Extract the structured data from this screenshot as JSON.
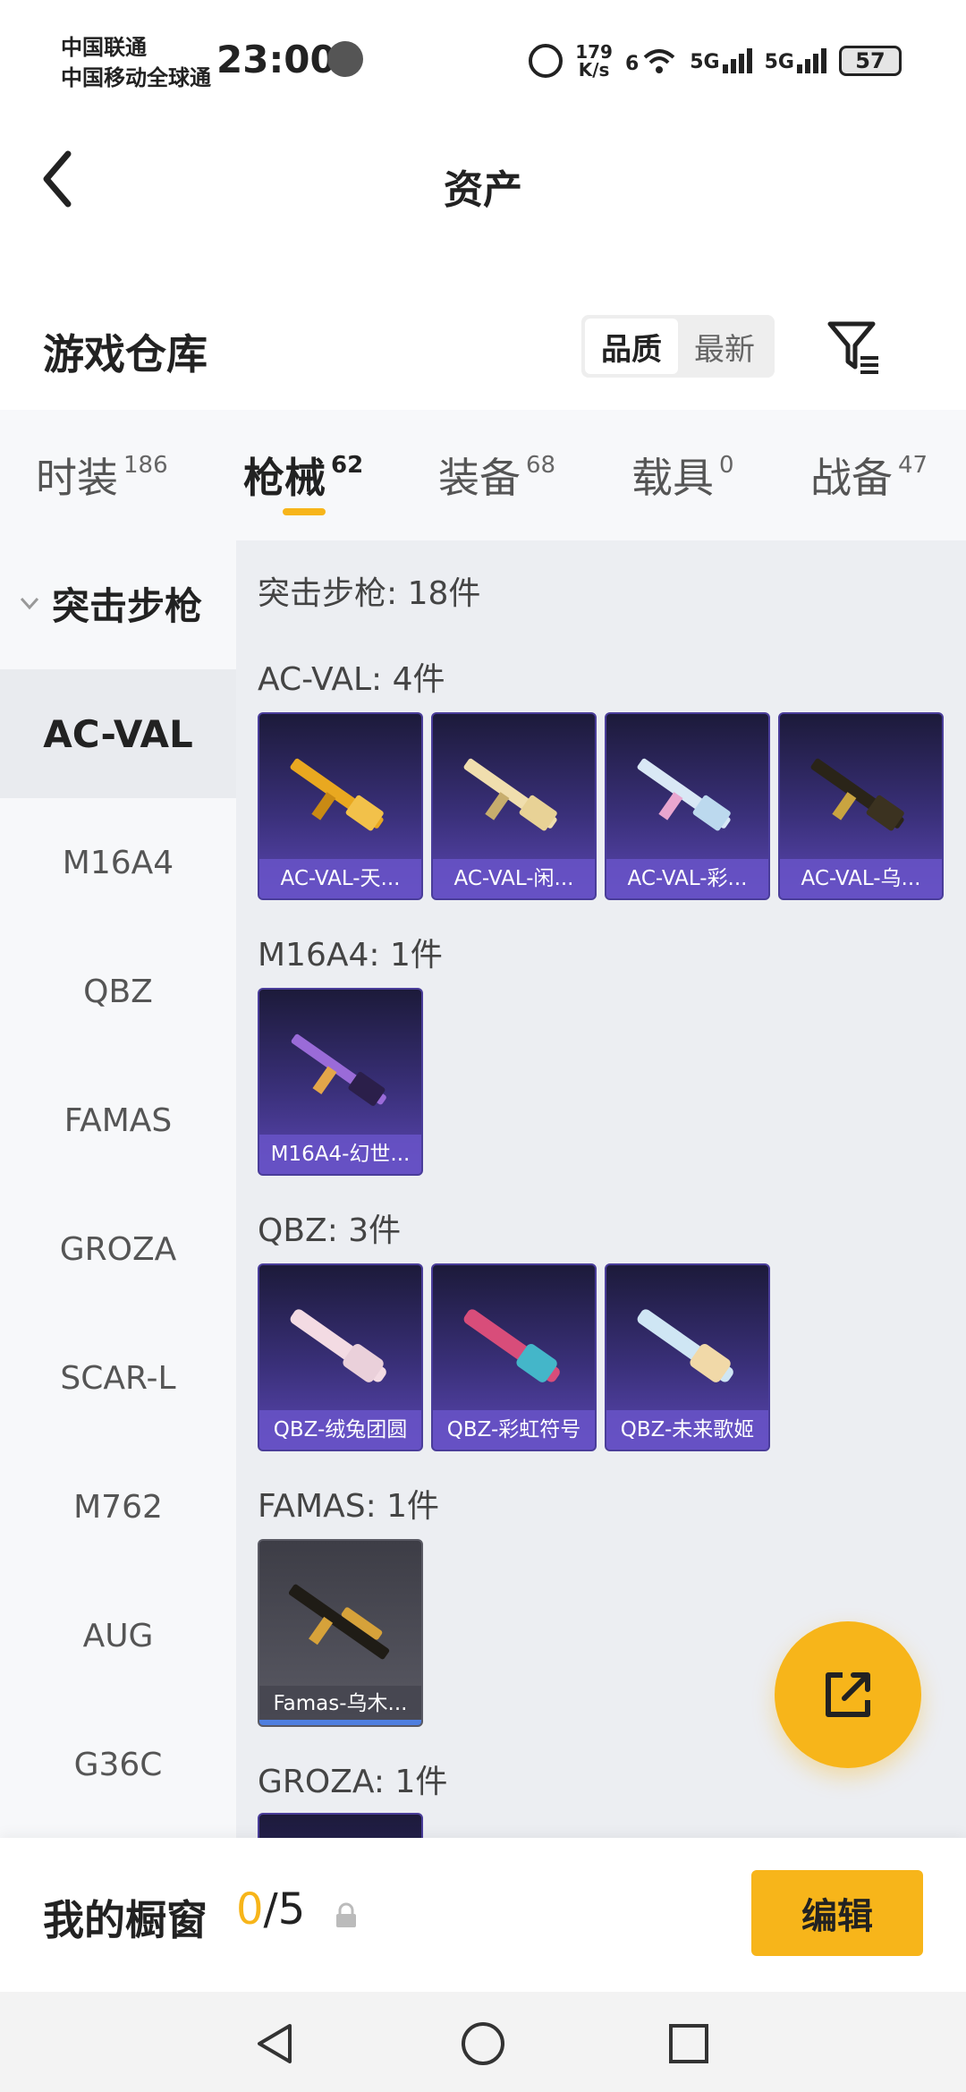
{
  "status_bar": {
    "carrier_1": "中国联通",
    "carrier_2": "中国移动全球通",
    "time": "23:00",
    "net_speed_value": "179",
    "net_speed_unit": "K/s",
    "wifi_label": "6",
    "signal_1": "5G",
    "signal_2": "5G",
    "battery": "57"
  },
  "header": {
    "title": "资产"
  },
  "warehouse": {
    "title": "游戏仓库",
    "sort_quality": "品质",
    "sort_newest": "最新",
    "active_sort": "品质"
  },
  "tabs": [
    {
      "label": "时装",
      "count": "186"
    },
    {
      "label": "枪械",
      "count": "62"
    },
    {
      "label": "装备",
      "count": "68"
    },
    {
      "label": "载具",
      "count": "0"
    },
    {
      "label": "战备",
      "count": "47"
    }
  ],
  "active_tab": "枪械",
  "sidebar": {
    "group_label": "突击步枪",
    "items": [
      "AC-VAL",
      "M16A4",
      "QBZ",
      "FAMAS",
      "GROZA",
      "SCAR-L",
      "M762",
      "AUG",
      "G36C"
    ],
    "active_item": "AC-VAL"
  },
  "content": {
    "total_text": "突击步枪: 18件",
    "sections": [
      {
        "header": "AC-VAL: 4件",
        "items": [
          "AC-VAL-天...",
          "AC-VAL-闲...",
          "AC-VAL-彩...",
          "AC-VAL-乌..."
        ]
      },
      {
        "header": "M16A4: 1件",
        "items": [
          "M16A4-幻世..."
        ]
      },
      {
        "header": "QBZ: 3件",
        "items": [
          "QBZ-绒兔团圆",
          "QBZ-彩虹符号",
          "QBZ-未来歌姬"
        ]
      },
      {
        "header": "FAMAS: 1件",
        "items": [
          "Famas-乌木..."
        ]
      },
      {
        "header": "GROZA: 1件",
        "items": []
      }
    ]
  },
  "showcase": {
    "title": "我的橱窗",
    "count_current": "0",
    "count_total": "/5",
    "edit_label": "编辑"
  },
  "colors": {
    "accent": "#f7b51a",
    "card_purple": "#3a307a",
    "card_label": "#6854c8",
    "sidebar_bg": "#f7f8fa",
    "content_bg": "#eceef2"
  }
}
